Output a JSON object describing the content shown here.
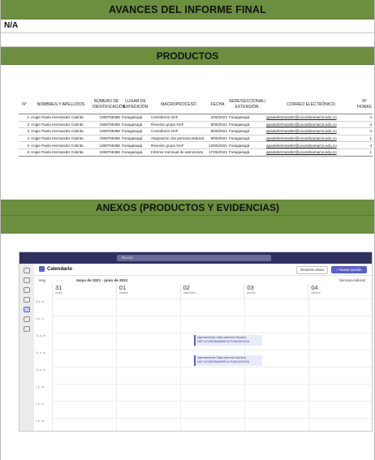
{
  "doc": {
    "title": "AVANCES DEL INFORME FINAL",
    "na": "N/A",
    "productos_heading": "PRODUCTOS",
    "anexos_heading": "ANEXOS (PRODUCTOS Y EVIDENCIAS)"
  },
  "table": {
    "headers": [
      "N°",
      "NOMBRES Y APELLIDOS",
      "NÚMERO DE IDENTIFICACIÓN",
      "LUGAR DE EXPEDICIÓN",
      "MACROPROCESO",
      "FECHA",
      "SEDE/SECCIONAL/ EXTENSIÓN",
      "CORREO ELECTRÓNICO",
      "N° HORAS"
    ],
    "rows": [
      [
        "1",
        "Angie Paola Hernandez Cabrita",
        "1069755386",
        "Fusagasugá",
        "Consultorio NAF",
        "2/05/2021",
        "Fusagasugá",
        "apaolahernandez@ucundinamarca.edu.co",
        "4"
      ],
      [
        "2",
        "Angie Paola Hernandez Cabrita",
        "1069755386",
        "Fusagasugá",
        "Reunión grupo NAF",
        "6/05/2021",
        "Fusagasugá",
        "apaolahernandez@ucundinamarca.edu.co",
        "4"
      ],
      [
        "3",
        "Angie Paola Hernandez Cabrita",
        "1069755386",
        "Fusagasugá",
        "Consultorio NAF",
        "9/05/2021",
        "Fusagasugá",
        "apaolahernandez@ucundinamarca.edu.co",
        "4"
      ],
      [
        "4",
        "Angie Paola Hernandez Cabrita",
        "1069755386",
        "Fusagasugá",
        "Asignación cita persona Natural",
        "9/05/2021",
        "Fusagasugá",
        "apaolahernandez@ucundinamarca.edu.co",
        "1"
      ],
      [
        "5",
        "Angie Paola Hernandez Cabrita",
        "1069755386",
        "Fusagasugá",
        "Reunión grupo NAF",
        "12/05/2021",
        "Fusagasugá",
        "apaolahernandez@ucundinamarca.edu.co",
        "4"
      ],
      [
        "6",
        "Angie Paola Hernandez Cabrita",
        "1069755386",
        "Fusagasugá",
        "Informe mensual de atenciones",
        "17/05/2021",
        "Fusagasugá",
        "apaolahernandez@ucundinamarca.edu.co",
        "1"
      ]
    ]
  },
  "teams": {
    "search_placeholder": "Buscar",
    "calendar_title": "Calendario",
    "meet_now_label": "Reunirse ahora",
    "new_meeting_label": "+ Nueva reunión",
    "today_label": "Hoy",
    "date_range": "mayo de 2021 - junio de 2021",
    "view_label": "Semana laboral",
    "days": [
      {
        "num": "31",
        "name": "lunes"
      },
      {
        "num": "01",
        "name": "martes"
      },
      {
        "num": "02",
        "name": "miércoles"
      },
      {
        "num": "03",
        "name": "jueves"
      },
      {
        "num": "04",
        "name": "viernes"
      }
    ],
    "hours": [
      "8 a. m.",
      "9 a. m.",
      "10 a. m.",
      "11 a. m.",
      "12 p. m.",
      "1 p. m.",
      "2 p. m.",
      "3 p. m."
    ],
    "events": [
      {
        "title": "Agendamiento Video atención Núcleos",
        "sub": "NAF UCUNDINAMARCA FUSAGASUGA"
      },
      {
        "title": "Agendamiento Video atención Núcleos",
        "sub": "NAF UCUNDINAMARCA FUSAGASUGA"
      }
    ],
    "accent": "#5b5fc7",
    "titlebar_color": "#2f3060"
  },
  "colors": {
    "section_green": "#6b8f3e"
  }
}
